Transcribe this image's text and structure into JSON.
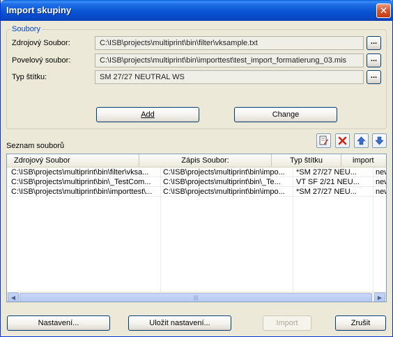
{
  "window": {
    "title": "Import skupiny",
    "close_glyph": "✕"
  },
  "source_group": {
    "title": "Soubory",
    "fields": [
      {
        "label": "Zdrojový Soubor:",
        "value": "C:\\ISB\\projects\\multiprint\\bin\\filter\\vksample.txt"
      },
      {
        "label": "Povelový soubor:",
        "value": "C:\\ISB\\projects\\multiprint\\bin\\importtest\\test_import_formatierung_03.mis"
      },
      {
        "label": "Typ štítku:",
        "value": "SM 27/27 NEUTRAL WS"
      }
    ],
    "browse_label": "...",
    "add_label": "Add",
    "change_label": "Change"
  },
  "file_list": {
    "label": "Seznam souborů",
    "toolbar_icons": [
      "edit-list-icon",
      "delete-icon",
      "move-up-icon",
      "move-down-icon"
    ],
    "columns": [
      "Zdrojový Soubor",
      "Zápis Soubor:",
      "Typ štítku",
      "import"
    ],
    "rows": [
      [
        "C:\\ISB\\projects\\multiprint\\bin\\filter\\vksa...",
        "C:\\ISB\\projects\\multiprint\\bin\\impo...",
        "*SM 27/27 NEU...",
        "new"
      ],
      [
        "C:\\ISB\\projects\\multiprint\\bin\\_TestCom...",
        "C:\\ISB\\projects\\multiprint\\bin\\_Te...",
        "VT SF 2/21 NEU...",
        "new"
      ],
      [
        "C:\\ISB\\projects\\multiprint\\bin\\importtest\\...",
        "C:\\ISB\\projects\\multiprint\\bin\\impo...",
        "*SM 27/27 NEU...",
        "new"
      ]
    ],
    "scroll_left": "◀",
    "scroll_right": "▶",
    "scroll_grip": "|||"
  },
  "footer": {
    "settings_label": "Nastavení...",
    "save_settings_label": "Uložit nastavení...",
    "import_label": "Import",
    "cancel_label": "Zrušit"
  }
}
